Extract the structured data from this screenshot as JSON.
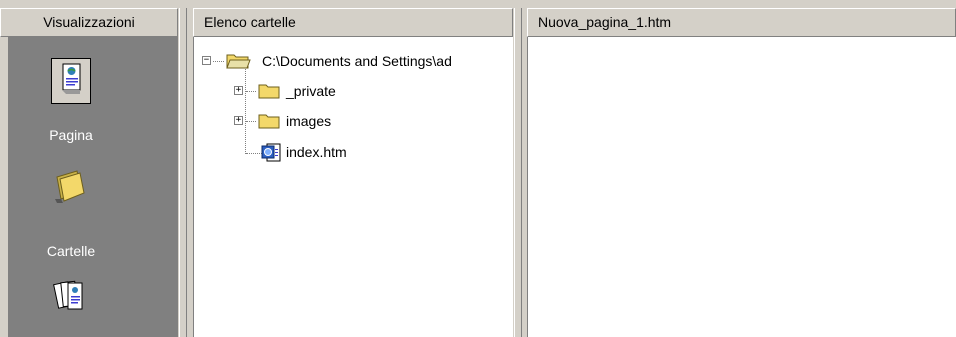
{
  "views_bar": {
    "title": "Visualizzazioni",
    "items": [
      {
        "label": "Pagina",
        "icon": "page-icon",
        "selected": true
      },
      {
        "label": "Cartelle",
        "icon": "folder-icon",
        "selected": false
      },
      {
        "label": "",
        "icon": "reports-icon",
        "selected": false
      }
    ]
  },
  "folder_list": {
    "title": "Elenco cartelle",
    "root": "C:\\Documents and Settings\\ad",
    "children": [
      {
        "label": "_private",
        "type": "folder"
      },
      {
        "label": "images",
        "type": "folder"
      },
      {
        "label": "index.htm",
        "type": "file"
      }
    ]
  },
  "page_view": {
    "title": "Nuova_pagina_1.htm"
  },
  "colors": {
    "chrome": "#d4d0c8",
    "views_bg": "#808080",
    "folder_yellow": "#f3d86a"
  }
}
